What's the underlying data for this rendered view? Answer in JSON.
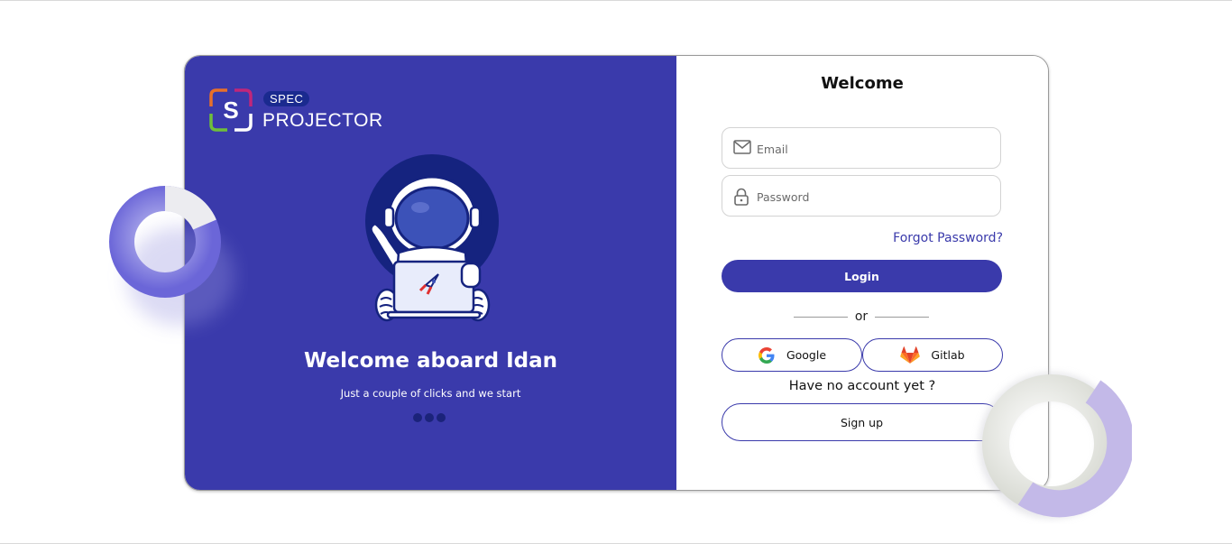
{
  "brand": {
    "spec_label": "SPEC",
    "name": "PROJECTOR",
    "mark_letter": "S"
  },
  "hero": {
    "title": "Welcome aboard Idan",
    "subtitle": "Just a couple of clicks and we start",
    "carousel_dots": 3
  },
  "form": {
    "title": "Welcome",
    "email_placeholder": "Email",
    "password_placeholder": "Password",
    "forgot_label": "Forgot Password?",
    "login_label": "Login",
    "or_label": "or",
    "google_label": "Google",
    "gitlab_label": "Gitlab",
    "no_account_label": "Have no account yet ?",
    "signup_label": "Sign up"
  },
  "colors": {
    "primary": "#3a3aab",
    "dark_navy": "#1a2a8f",
    "background": "#ffffff"
  },
  "icons": {
    "email": "envelope-icon",
    "password": "lock-icon",
    "google": "google-icon",
    "gitlab": "gitlab-icon"
  }
}
